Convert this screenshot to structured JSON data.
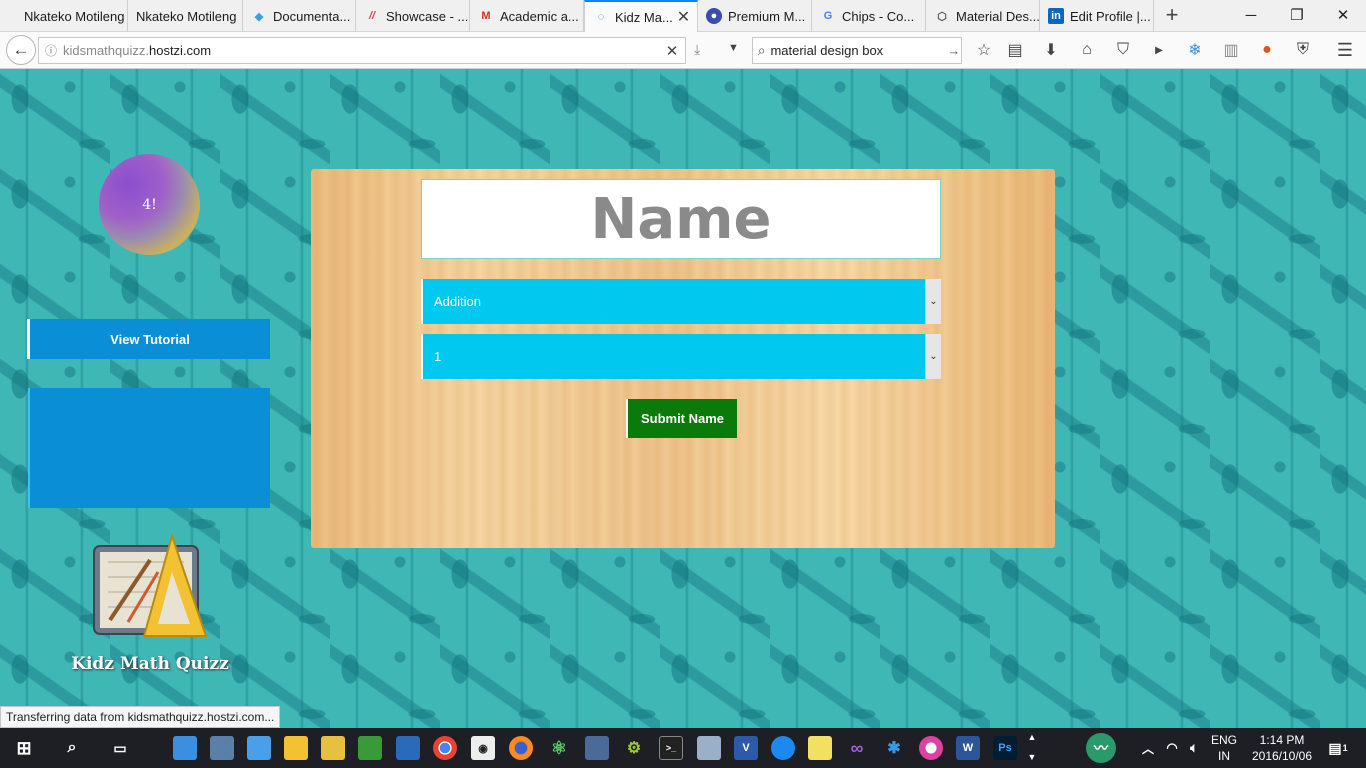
{
  "browser": {
    "tabs": [
      {
        "label": "Nkateko Motileng",
        "favicon": "",
        "active": false
      },
      {
        "label": "Nkateko Motileng",
        "favicon": "",
        "active": false
      },
      {
        "label": "Documenta...",
        "favicon": "documentation-icon",
        "active": false
      },
      {
        "label": "Showcase - ...",
        "favicon": "showcase-icon",
        "active": false
      },
      {
        "label": "Academic a...",
        "favicon": "gmail-icon",
        "active": false
      },
      {
        "label": "Kidz Ma...",
        "favicon": "loading-icon",
        "active": true
      },
      {
        "label": "Premium M...",
        "favicon": "premium-icon",
        "active": false
      },
      {
        "label": "Chips - Co...",
        "favicon": "google-icon",
        "active": false
      },
      {
        "label": "Material Des...",
        "favicon": "material-icon",
        "active": false
      },
      {
        "label": "Edit Profile |...",
        "favicon": "linkedin-icon",
        "active": false
      }
    ],
    "url_prefix": "kidsmathquizz.",
    "url_domain": "hostzi.com",
    "search_value": "material design box"
  },
  "page": {
    "avatar_text": "4!",
    "tutorial_label": "View Tutorial",
    "name_placeholder": "Name",
    "operation_value": "Addition",
    "level_value": "1",
    "submit_label": "Submit Name",
    "logo_title": "Kidz Math Quizz",
    "status_text": "Transferring data from kidsmathquizz.hostzi.com..."
  },
  "taskbar": {
    "lang_top": "ENG",
    "lang_bottom": "IN",
    "time": "1:14 PM",
    "date": "2016/10/06",
    "notifications": "1"
  },
  "colors": {
    "tutorial_blue": "#0a8fd6",
    "select_cyan": "#00c8ee",
    "submit_green": "#0a7a0a",
    "background_teal": "#3fb7b5",
    "card_wood": "#efc58a"
  }
}
